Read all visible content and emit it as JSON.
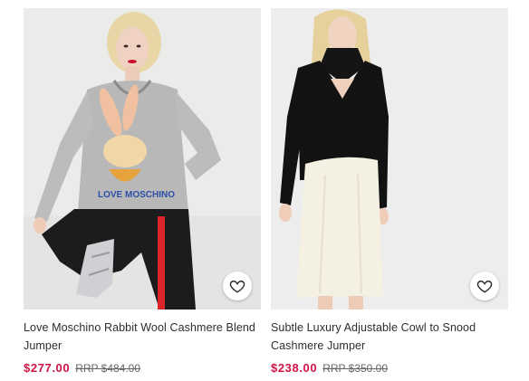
{
  "colors": {
    "price": "#d01345",
    "text": "#2d2d2d",
    "rrp": "#666666",
    "image_bg": "#ececec"
  },
  "products": [
    {
      "title": "Love Moschino Rabbit Wool Cashmere Blend Jumper",
      "price": "$277.00",
      "rrp": "RRP $484.00",
      "save_icon": "heart-outline-icon",
      "image_description_icon": "product-photo"
    },
    {
      "title": "Subtle Luxury Adjustable Cowl to Snood Cashmere Jumper",
      "price": "$238.00",
      "rrp": "RRP $350.00",
      "save_icon": "heart-outline-icon",
      "image_description_icon": "product-photo"
    }
  ]
}
